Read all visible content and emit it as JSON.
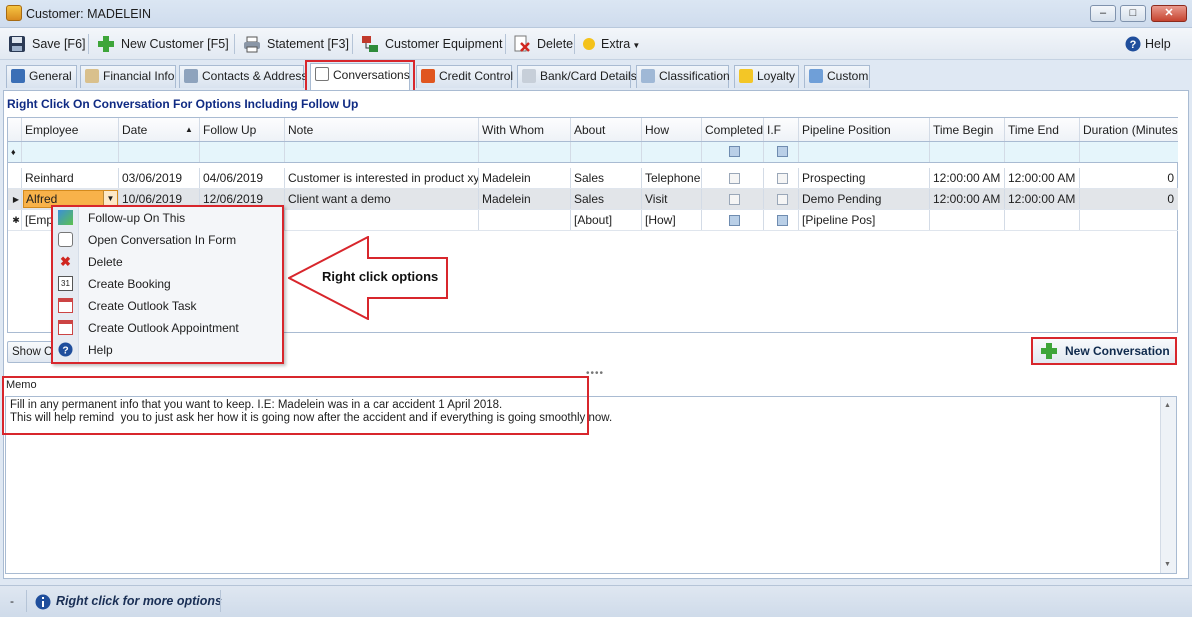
{
  "window": {
    "title": "Customer: MADELEIN"
  },
  "toolbar": {
    "save": "Save [F6]",
    "new_customer": "New Customer [F5]",
    "statement": "Statement [F3]",
    "customer_equipment": "Customer Equipment",
    "delete": "Delete",
    "extra": "Extra",
    "help": "Help"
  },
  "tabs": [
    "General",
    "Financial Info",
    "Contacts & Address",
    "Conversations",
    "Credit Control",
    "Bank/Card Details",
    "Classification",
    "Loyalty",
    "Custom"
  ],
  "active_tab": "Conversations",
  "hint": "Right Click On Conversation For Options Including Follow Up",
  "grid": {
    "columns": [
      "Employee",
      "Date",
      "Follow Up",
      "Note",
      "With Whom",
      "About",
      "How",
      "Completed",
      "I.F",
      "Pipeline Position",
      "Time Begin",
      "Time End",
      "Duration (Minutes)"
    ],
    "rows": [
      {
        "employee": "Reinhard",
        "date": "03/06/2019",
        "follow_up": "04/06/2019",
        "note": "Customer is interested in product xy...",
        "with_whom": "Madelein",
        "about": "Sales",
        "how": "Telephone",
        "pipeline": "Prospecting",
        "time_begin": "12:00:00 AM",
        "time_end": "12:00:00 AM",
        "duration": "0"
      },
      {
        "employee": "Alfred",
        "date": "10/06/2019",
        "follow_up": "12/06/2019",
        "note": "Client want a demo",
        "with_whom": "Madelein",
        "about": "Sales",
        "how": "Visit",
        "pipeline": "Demo Pending",
        "time_begin": "12:00:00 AM",
        "time_end": "12:00:00 AM",
        "duration": "0"
      }
    ],
    "new_row": {
      "employee": "[Emp",
      "about": "[About]",
      "how": "[How]",
      "pipeline": "[Pipeline Pos]"
    }
  },
  "context_menu": [
    "Follow-up On This",
    "Open Conversation In Form",
    "Delete",
    "Create Booking",
    "Create Outlook Task",
    "Create Outlook Appointment",
    "Help"
  ],
  "callout": "Right click options",
  "show_button": "Show Cu",
  "new_conversation": "New Conversation",
  "memo": {
    "label": "Memo",
    "line1": "Fill in any permanent info that you want to keep. I.E: Madelein was in a car accident 1 April 2018.",
    "line2": "This will help remind  you to just ask her how it is going now after the accident and if everything is going smoothly now."
  },
  "status": {
    "left": "-",
    "text": "Right click for more options"
  },
  "colors": {
    "highlight": "#d8262c",
    "hint_text": "#0f2a83",
    "editor": "#f8b24a",
    "filter_row": "#e5f5fb"
  }
}
